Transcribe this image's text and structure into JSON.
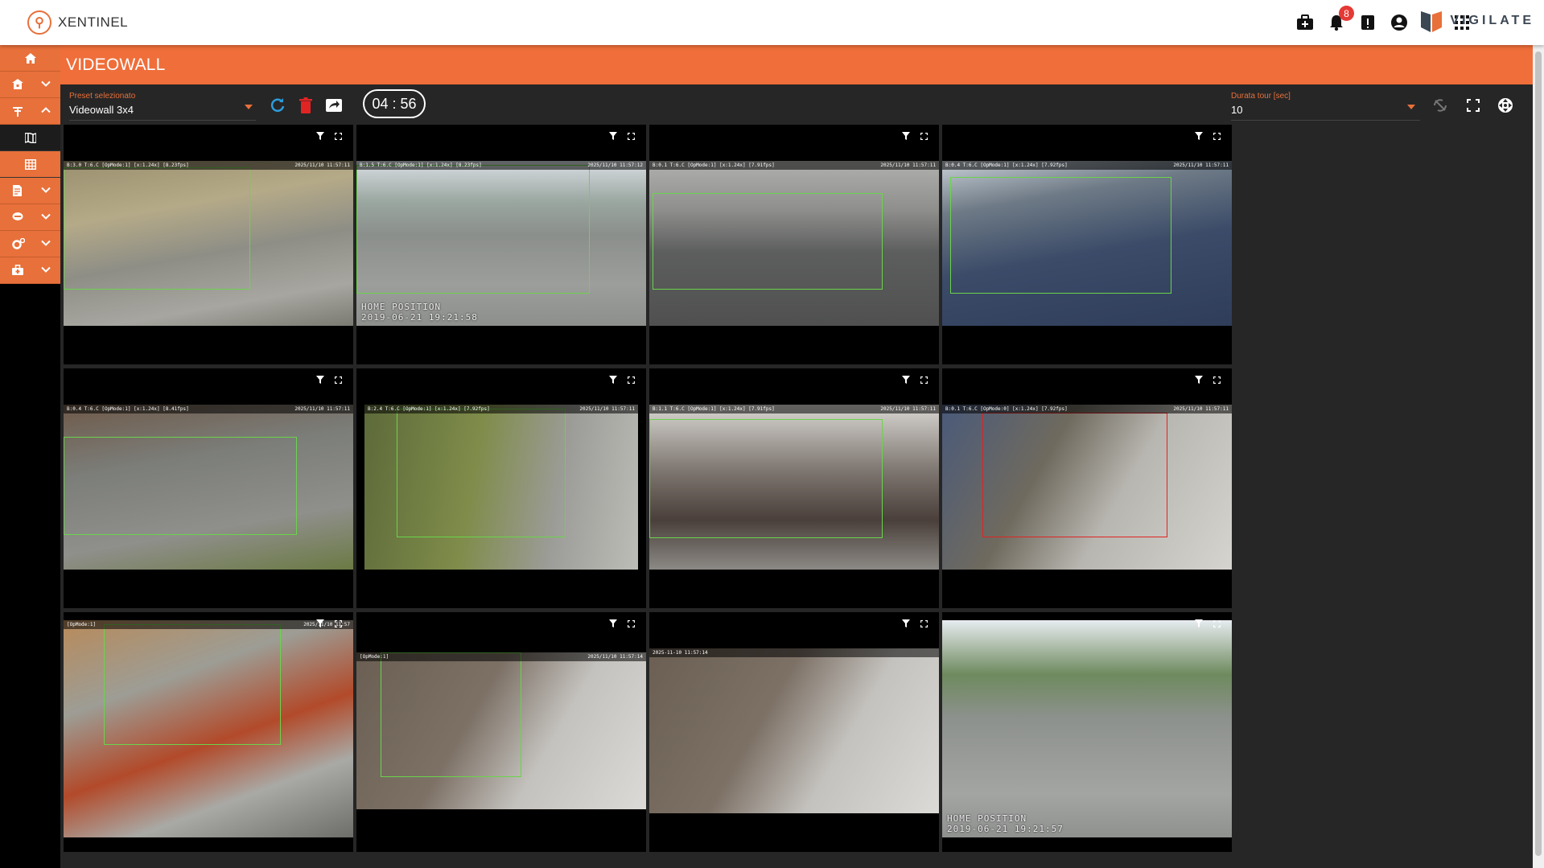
{
  "app": {
    "name": "XENTINEL",
    "partner": "VIGILATE"
  },
  "topbar": {
    "notifications_count": "8",
    "language_flag": "italy-flag-icon"
  },
  "sidebar": {
    "items": [
      {
        "icon": "home-icon",
        "has_chevron": false
      },
      {
        "icon": "building-icon",
        "has_chevron": true
      },
      {
        "icon": "antenna-icon",
        "has_chevron": true,
        "expanded": true
      },
      {
        "icon": "map-icon",
        "has_chevron": false
      },
      {
        "icon": "grid-icon",
        "has_chevron": false,
        "active": true
      },
      {
        "icon": "report-icon",
        "has_chevron": true
      },
      {
        "icon": "camera-icon",
        "has_chevron": true
      },
      {
        "icon": "settings-icon",
        "has_chevron": true
      },
      {
        "icon": "toolbox-icon",
        "has_chevron": true
      }
    ]
  },
  "page": {
    "title": "VIDEOWALL"
  },
  "toolbar": {
    "preset_label": "Preset selezionato",
    "preset_value": "Videowall 3x4",
    "timer": "04 : 56",
    "duration_label": "Durata tour [sec]",
    "duration_value": "10"
  },
  "colors": {
    "accent": "#ef6e3a",
    "zone_green": "#6ad44b",
    "zone_red": "#e02424"
  },
  "cameras": [
    {
      "osd_left": "B:3.0 T:6.C  [OpMode:1] [x:1.24x] [8.23fps]",
      "osd_right": "2025/11/10 11:57:11",
      "stamp": ""
    },
    {
      "osd_left": "B:1.5 T:6.C  [OpMode:1] [x:1.24x] [8.23fps]",
      "osd_right": "2025/11/10 11:57:12",
      "stamp": "HOME POSITION\n2019-06-21 19:21:58"
    },
    {
      "osd_left": "B:0.1 T:6.C  [OpMode:1] [x:1.24x] [7.91fps]",
      "osd_right": "2025/11/10 11:57:11",
      "stamp": ""
    },
    {
      "osd_left": "B:0.4 T:6.C  [OpMode:1] [x:1.24x] [7.92fps]",
      "osd_right": "2025/11/10 11:57:11",
      "stamp": ""
    },
    {
      "osd_left": "B:0.4 T:6.C  [OpMode:1] [x:1.24x] [8.41fps]",
      "osd_right": "2025/11/10 11:57:11",
      "stamp": ""
    },
    {
      "osd_left": "B:2.4 T:6.C  [OpMode:1] [x:1.24x] [7.92fps]",
      "osd_right": "2025/11/10 11:57:11",
      "stamp": ""
    },
    {
      "osd_left": "B:1.1 T:6.C  [OpMode:1] [x:1.24x] [7.91fps]",
      "osd_right": "2025/11/10 11:57:11",
      "stamp": ""
    },
    {
      "osd_left": "B:0.1 T:6.C  [OpMode:0] [x:1.24x] [7.92fps]",
      "osd_right": "2025/11/10 11:57:11",
      "stamp": ""
    },
    {
      "osd_left": "[OpMode:1]",
      "osd_right": "2025/11/10 11:57",
      "stamp": ""
    },
    {
      "osd_left": "[OpMode:1]",
      "osd_right": "2025/11/10 11:57:14",
      "stamp": ""
    },
    {
      "osd_left": "2025-11-10 11:57:14",
      "osd_right": "",
      "stamp": ""
    },
    {
      "osd_left": "",
      "osd_right": "",
      "stamp": "HOME POSITION\n2019-06-21 19:21:57"
    }
  ]
}
